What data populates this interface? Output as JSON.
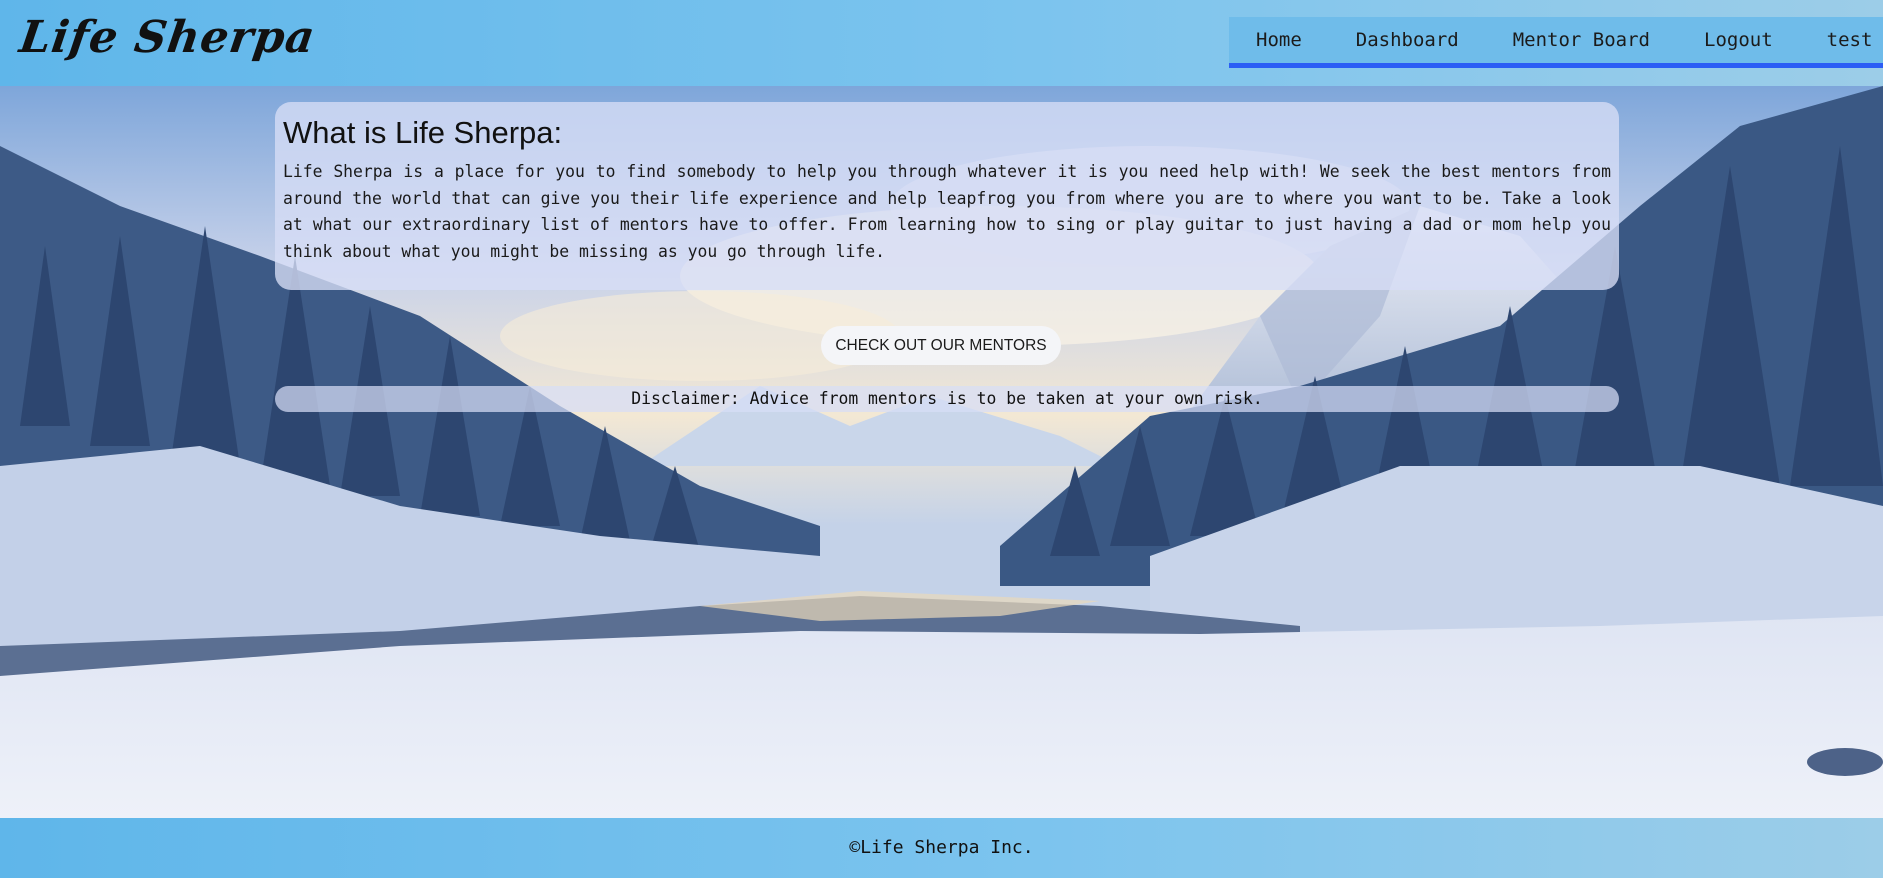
{
  "header": {
    "logo": "Life Sherpa",
    "nav": [
      "Home",
      "Dashboard",
      "Mentor Board",
      "Logout",
      "test"
    ]
  },
  "about": {
    "title": "What is Life Sherpa:",
    "body": "Life Sherpa is a place for you to find somebody to help you through whatever it is you need help with! We seek the best mentors from around the world that can give you their life experience and help leapfrog you from where you are to where you want to be. Take a look at what our extraordinary list of mentors have to offer. From learning how to sing or play guitar to just having a dad or mom help you think about what you might be missing as you go through life."
  },
  "cta_label": "CHECK OUT OUR MENTORS",
  "disclaimer": "Disclaimer: Advice from mentors is to be taken at your own risk.",
  "footer": "©Life Sherpa Inc.",
  "colors": {
    "header_bg": "#6fbcea",
    "nav_underline": "#2b5df5",
    "panel_bg": "#d7def6"
  }
}
